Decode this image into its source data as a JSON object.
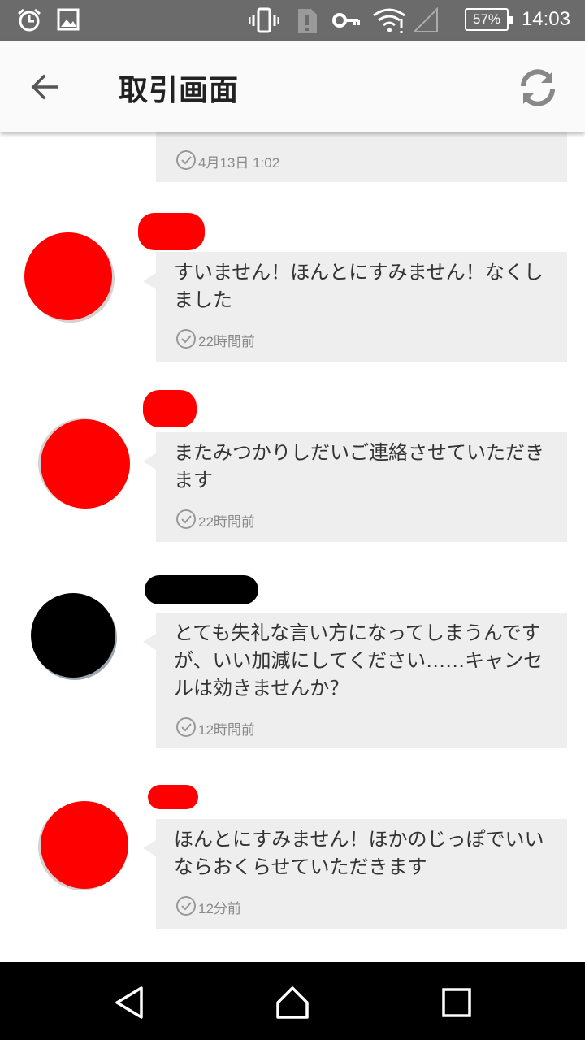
{
  "status_bar": {
    "time": "14:03",
    "battery": "57%",
    "icons": [
      "alarm-icon",
      "image-icon",
      "vibrate-icon",
      "sim-alert-icon",
      "vpn-key-icon",
      "wifi-icon",
      "signal-icon",
      "battery-icon"
    ]
  },
  "app_bar": {
    "title": "取引画面",
    "back_icon": "arrow-back-icon",
    "refresh_icon": "refresh-icon"
  },
  "messages": [
    {
      "text": "",
      "time": "4月13日 1:02",
      "avatar_color": "",
      "name_color": ""
    },
    {
      "text": "すいません！ほんとにすみません！なくしました",
      "time": "22時間前",
      "avatar_color": "#ff0000",
      "name_color": "#ff0000"
    },
    {
      "text": "またみつかりしだいご連絡させていただきます",
      "time": "22時間前",
      "avatar_color": "#ff0000",
      "name_color": "#ff0000"
    },
    {
      "text": "とても失礼な言い方になってしまうんですが、いい加減にしてください……キャンセルは効きませんか？",
      "time": "12時間前",
      "avatar_color": "#000000",
      "name_color": "#000000"
    },
    {
      "text": "ほんとにすみません！ほかのじっぽでいいならおくらせていただきます",
      "time": "12分前",
      "avatar_color": "#ff0000",
      "name_color": "#ff0000"
    }
  ],
  "nav_bar": {
    "back": "nav-back-icon",
    "home": "nav-home-icon",
    "recents": "nav-recents-icon"
  }
}
